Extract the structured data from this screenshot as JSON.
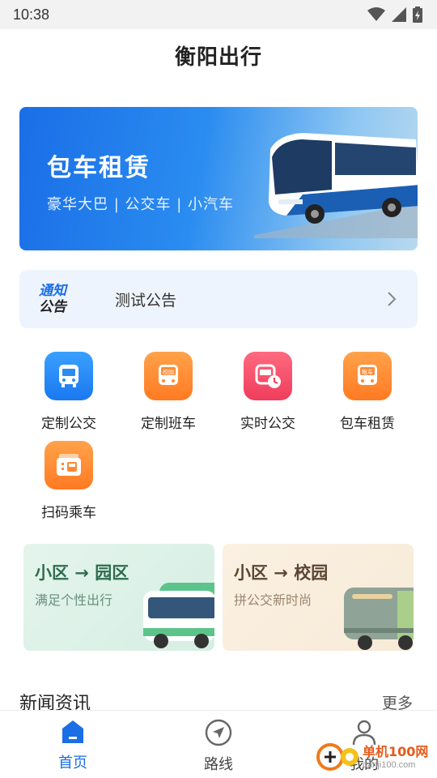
{
  "status": {
    "time": "10:38"
  },
  "app": {
    "title": "衡阳出行"
  },
  "banner": {
    "title": "包车租赁",
    "subtitle": "豪华大巴 | 公交车 | 小汽车"
  },
  "notice": {
    "badge_line1": "通知",
    "badge_line2": "公告",
    "text": "测试公告"
  },
  "services": [
    {
      "label": "定制公交",
      "icon": "bus-icon",
      "color": "#2a8cf0"
    },
    {
      "label": "定制班车",
      "icon": "campus-bus-icon",
      "badge": "校园",
      "color": "#ff8a34"
    },
    {
      "label": "实时公交",
      "icon": "realtime-bus-icon",
      "color": "#f5506a"
    },
    {
      "label": "包车租赁",
      "icon": "rental-bus-icon",
      "badge": "租车",
      "color": "#ff8a34"
    },
    {
      "label": "扫码乘车",
      "icon": "scan-ticket-icon",
      "color": "#ff8a34"
    }
  ],
  "cards": [
    {
      "title": "小区 → 园区",
      "subtitle": "满足个性出行",
      "title_color": "#2e6b4e"
    },
    {
      "title": "小区 → 校园",
      "subtitle": "拼公交新时尚",
      "title_color": "#6b4a2a"
    }
  ],
  "news": {
    "title": "新闻资讯",
    "more": "更多"
  },
  "tabs": [
    {
      "label": "首页",
      "icon": "home-icon"
    },
    {
      "label": "路线",
      "icon": "navigation-icon"
    },
    {
      "label": "我的",
      "icon": "profile-icon"
    }
  ],
  "watermark": {
    "name": "单机100网",
    "url": "danji100.com"
  },
  "colors": {
    "primary": "#1a6ee6"
  }
}
